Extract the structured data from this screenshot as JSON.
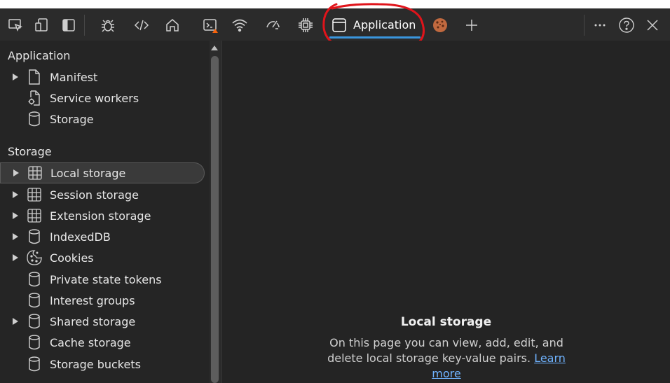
{
  "toolbar": {
    "icons": [
      "inspect-icon",
      "device-emulation-icon",
      "dock-side-icon",
      "bug-icon",
      "code-icon",
      "home-icon",
      "console-icon",
      "wifi-icon",
      "performance-icon",
      "memory-icon",
      "application-icon",
      "cookie-icon",
      "plus-icon",
      "more-icon",
      "help-icon",
      "close-icon"
    ],
    "active_tab_label": "Application"
  },
  "sidebar": {
    "section_application": "Application",
    "application_items": [
      {
        "label": "Manifest",
        "icon": "document-icon",
        "expandable": true
      },
      {
        "label": "Service workers",
        "icon": "gear-document-icon",
        "expandable": false
      },
      {
        "label": "Storage",
        "icon": "database-icon",
        "expandable": false
      }
    ],
    "section_storage": "Storage",
    "storage_items": [
      {
        "label": "Local storage",
        "icon": "grid-icon",
        "expandable": true,
        "selected": true
      },
      {
        "label": "Session storage",
        "icon": "grid-icon",
        "expandable": true
      },
      {
        "label": "Extension storage",
        "icon": "grid-icon",
        "expandable": true
      },
      {
        "label": "IndexedDB",
        "icon": "database-icon",
        "expandable": true
      },
      {
        "label": "Cookies",
        "icon": "cookie-outline-icon",
        "expandable": true
      },
      {
        "label": "Private state tokens",
        "icon": "database-icon",
        "expandable": false
      },
      {
        "label": "Interest groups",
        "icon": "database-icon",
        "expandable": false
      },
      {
        "label": "Shared storage",
        "icon": "database-icon",
        "expandable": true
      },
      {
        "label": "Cache storage",
        "icon": "database-icon",
        "expandable": false
      },
      {
        "label": "Storage buckets",
        "icon": "database-icon",
        "expandable": false
      }
    ]
  },
  "main": {
    "title": "Local storage",
    "description": "On this page you can view, add, edit, and delete local storage key-value pairs.",
    "learn_more": "Learn more"
  },
  "colors": {
    "accent": "#3a96dd",
    "annotation": "#e0141b",
    "warning": "#f7630c"
  }
}
